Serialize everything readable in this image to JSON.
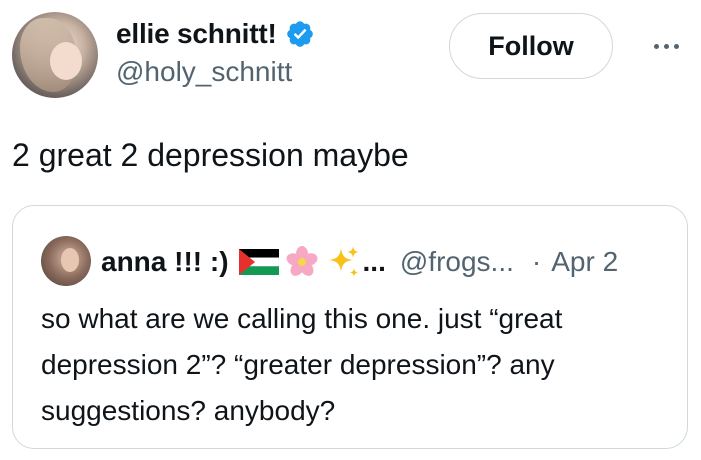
{
  "author": {
    "display_name": "ellie schnitt!",
    "handle": "@holy_schnitt",
    "verified": true,
    "avatar_icon": "profile-photo"
  },
  "actions": {
    "follow_label": "Follow",
    "more_icon": "ellipsis-horizontal-icon"
  },
  "tweet": {
    "text": "2 great 2 depression maybe"
  },
  "quoted_tweet": {
    "display_name": "anna !!! :)",
    "name_emojis": [
      "palestine-flag",
      "cherry-blossom",
      "sparkles"
    ],
    "ellipsis": "...",
    "handle": "@frogs...",
    "separator": "·",
    "date": "Apr 2",
    "text": "so what are we calling this one. just “great depression 2”? “greater depression”? any suggestions? anybody?"
  },
  "colors": {
    "verified_blue": "#1d9bf0",
    "secondary_text": "#536471",
    "border": "#cfd9de",
    "primary_text": "#0f1419"
  }
}
